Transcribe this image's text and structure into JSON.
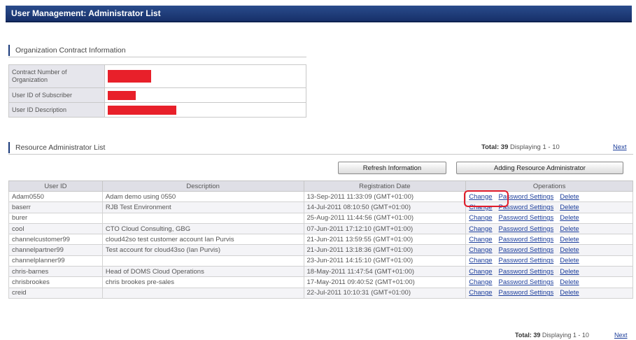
{
  "window": {
    "title": "User Management: Administrator List"
  },
  "org_section": {
    "heading": "Organization Contract Information",
    "rows": [
      {
        "label": "Contract Number of Organization",
        "redacted": true
      },
      {
        "label": "User ID of Subscriber",
        "redacted": true
      },
      {
        "label": "User ID Description",
        "redacted": true
      }
    ]
  },
  "admin_section": {
    "heading": "Resource Administrator List",
    "total_label": "Total:",
    "total_value": "39",
    "displaying": "Displaying 1 - 10",
    "next_label": "Next",
    "refresh_button": "Refresh Information",
    "add_button": "Adding Resource Administrator",
    "columns": [
      "User ID",
      "Description",
      "Registration Date",
      "Operations"
    ],
    "operations": {
      "change": "Change",
      "password": "Password Settings",
      "delete": "Delete"
    },
    "rows": [
      {
        "user_id": "Adam0550",
        "description": "Adam demo using 0550",
        "registration": "13-Sep-2011 11:33:09 (GMT+01:00)"
      },
      {
        "user_id": "baserr",
        "description": "RJB Test Environment",
        "registration": "14-Jul-2011 08:10:50 (GMT+01:00)"
      },
      {
        "user_id": "burer",
        "description": "",
        "registration": "25-Aug-2011 11:44:56 (GMT+01:00)"
      },
      {
        "user_id": "cool",
        "description": "CTO Cloud Consulting, GBG",
        "registration": "07-Jun-2011 17:12:10 (GMT+01:00)"
      },
      {
        "user_id": "channelcustomer99",
        "description": "cloud42so test customer account Ian Purvis",
        "registration": "21-Jun-2011 13:59:55 (GMT+01:00)"
      },
      {
        "user_id": "channelpartner99",
        "description": "Test account for cloud43so (Ian Purvis)",
        "registration": "21-Jun-2011 13:18:36 (GMT+01:00)"
      },
      {
        "user_id": "channelplanner99",
        "description": "",
        "registration": "23-Jun-2011 14:15:10 (GMT+01:00)"
      },
      {
        "user_id": "chris-barnes",
        "description": "Head of DOMS Cloud Operations",
        "registration": "18-May-2011 11:47:54 (GMT+01:00)"
      },
      {
        "user_id": "chrisbrookes",
        "description": "chris brookes pre-sales",
        "registration": "17-May-2011 09:40:52 (GMT+01:00)"
      },
      {
        "user_id": "creid",
        "description": "",
        "registration": "22-Jul-2011 10:10:31 (GMT+01:00)"
      }
    ]
  }
}
